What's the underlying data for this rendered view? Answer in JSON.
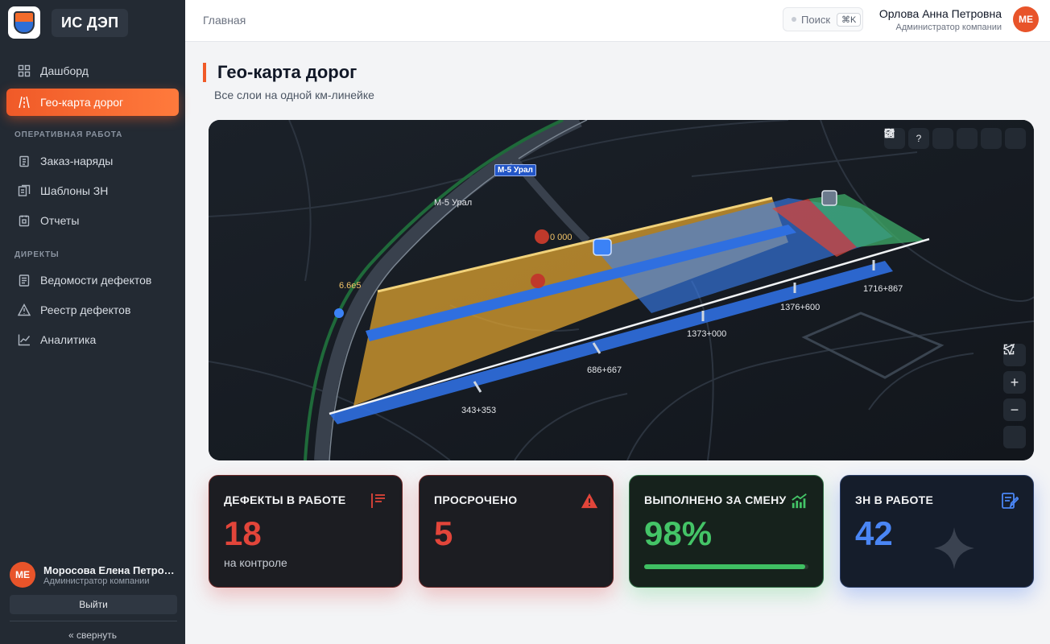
{
  "app": {
    "brand_name": "ИС ДЭП"
  },
  "sidebar": {
    "items": [
      {
        "label": "Дашборд",
        "icon": "dashboard-icon"
      },
      {
        "label": "Гео-карта дорог",
        "icon": "road-icon",
        "active": true
      }
    ],
    "sections": [
      {
        "title": "ОПЕРАТИВНАЯ РАБОТА",
        "items": [
          {
            "label": "Заказ-наряды",
            "icon": "clipboard-icon"
          },
          {
            "label": "Шаблоны ЗН",
            "icon": "templates-icon"
          },
          {
            "label": "Отчеты",
            "icon": "report-icon"
          }
        ]
      },
      {
        "title": "ДИРЕКТЫ",
        "items": [
          {
            "label": "Ведомости дефектов",
            "icon": "list-icon"
          },
          {
            "label": "Реестр дефектов",
            "icon": "warning-icon"
          },
          {
            "label": "Аналитика",
            "icon": "chart-icon"
          }
        ]
      }
    ],
    "user": {
      "initials": "МЕ",
      "name": "Моросова Елена Петровн...",
      "role": "Администратор компании"
    },
    "logout_label": "Выйти",
    "collapse_label": "« свернуть"
  },
  "header": {
    "breadcrumb": "Главная",
    "search": {
      "label": "Поиск",
      "shortcut": "⌘K"
    },
    "user": {
      "name": "Орлова Анна Петровна",
      "role": "Администратор компании",
      "initials": "МЕ"
    }
  },
  "page": {
    "title": "Гео-карта дорог",
    "subtitle": "Все слои на одной км-линейке"
  },
  "map": {
    "labels": {
      "road_sign": "М-5 Урал",
      "road_name": "М-5 Урал",
      "left_marker": "6.6е5",
      "top_marker": "0 000"
    },
    "km_labels": [
      "343+353",
      "686+667",
      "1373+000",
      "1376+600",
      "1716+867"
    ],
    "toolbar": [
      "search-icon",
      "help-icon",
      "calendar-icon",
      "edit-icon",
      "layers-icon",
      "expand-icon"
    ],
    "controls": [
      "fullscreen-icon",
      "zoom-in-icon",
      "zoom-out-icon",
      "locate-icon"
    ],
    "legend_colors": {
      "in_progress": "#e5a62f",
      "planned": "#3b82f6",
      "critical": "#d6453a",
      "done": "#3fae6a"
    }
  },
  "stats": [
    {
      "title": "ДЕФЕКТЫ В РАБОТЕ",
      "value": "18",
      "sub": "на контроле",
      "color": "#e2453a",
      "icon": "list-icon"
    },
    {
      "title": "ПРОСРОЧЕНО",
      "value": "5",
      "color": "#e2453a",
      "icon": "alert-icon"
    },
    {
      "title": "ВЫПОЛНЕНО ЗА СМЕНУ",
      "value": "98%",
      "progress": 0.98,
      "color": "#44c467",
      "icon": "growth-icon"
    },
    {
      "title": "ЗН В РАБОТЕ",
      "value": "42",
      "color": "#4a86f5",
      "icon": "document-icon"
    }
  ]
}
